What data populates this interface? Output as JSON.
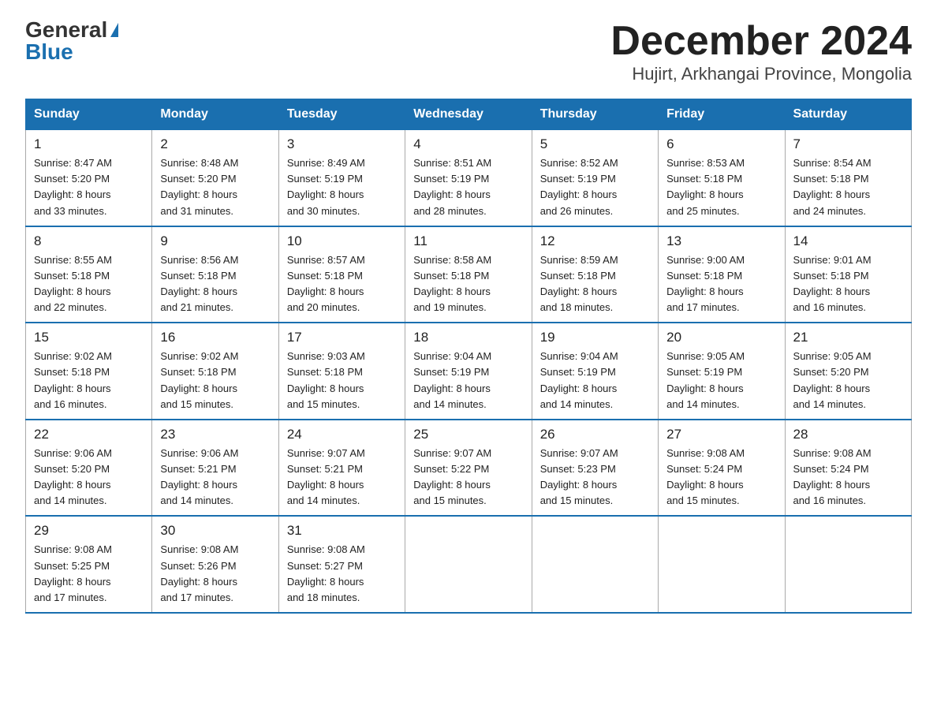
{
  "logo": {
    "general": "General",
    "blue": "Blue"
  },
  "title": "December 2024",
  "subtitle": "Hujirt, Arkhangai Province, Mongolia",
  "weekdays": [
    "Sunday",
    "Monday",
    "Tuesday",
    "Wednesday",
    "Thursday",
    "Friday",
    "Saturday"
  ],
  "weeks": [
    [
      {
        "day": "1",
        "sunrise": "8:47 AM",
        "sunset": "5:20 PM",
        "daylight": "8 hours and 33 minutes."
      },
      {
        "day": "2",
        "sunrise": "8:48 AM",
        "sunset": "5:20 PM",
        "daylight": "8 hours and 31 minutes."
      },
      {
        "day": "3",
        "sunrise": "8:49 AM",
        "sunset": "5:19 PM",
        "daylight": "8 hours and 30 minutes."
      },
      {
        "day": "4",
        "sunrise": "8:51 AM",
        "sunset": "5:19 PM",
        "daylight": "8 hours and 28 minutes."
      },
      {
        "day": "5",
        "sunrise": "8:52 AM",
        "sunset": "5:19 PM",
        "daylight": "8 hours and 26 minutes."
      },
      {
        "day": "6",
        "sunrise": "8:53 AM",
        "sunset": "5:18 PM",
        "daylight": "8 hours and 25 minutes."
      },
      {
        "day": "7",
        "sunrise": "8:54 AM",
        "sunset": "5:18 PM",
        "daylight": "8 hours and 24 minutes."
      }
    ],
    [
      {
        "day": "8",
        "sunrise": "8:55 AM",
        "sunset": "5:18 PM",
        "daylight": "8 hours and 22 minutes."
      },
      {
        "day": "9",
        "sunrise": "8:56 AM",
        "sunset": "5:18 PM",
        "daylight": "8 hours and 21 minutes."
      },
      {
        "day": "10",
        "sunrise": "8:57 AM",
        "sunset": "5:18 PM",
        "daylight": "8 hours and 20 minutes."
      },
      {
        "day": "11",
        "sunrise": "8:58 AM",
        "sunset": "5:18 PM",
        "daylight": "8 hours and 19 minutes."
      },
      {
        "day": "12",
        "sunrise": "8:59 AM",
        "sunset": "5:18 PM",
        "daylight": "8 hours and 18 minutes."
      },
      {
        "day": "13",
        "sunrise": "9:00 AM",
        "sunset": "5:18 PM",
        "daylight": "8 hours and 17 minutes."
      },
      {
        "day": "14",
        "sunrise": "9:01 AM",
        "sunset": "5:18 PM",
        "daylight": "8 hours and 16 minutes."
      }
    ],
    [
      {
        "day": "15",
        "sunrise": "9:02 AM",
        "sunset": "5:18 PM",
        "daylight": "8 hours and 16 minutes."
      },
      {
        "day": "16",
        "sunrise": "9:02 AM",
        "sunset": "5:18 PM",
        "daylight": "8 hours and 15 minutes."
      },
      {
        "day": "17",
        "sunrise": "9:03 AM",
        "sunset": "5:18 PM",
        "daylight": "8 hours and 15 minutes."
      },
      {
        "day": "18",
        "sunrise": "9:04 AM",
        "sunset": "5:19 PM",
        "daylight": "8 hours and 14 minutes."
      },
      {
        "day": "19",
        "sunrise": "9:04 AM",
        "sunset": "5:19 PM",
        "daylight": "8 hours and 14 minutes."
      },
      {
        "day": "20",
        "sunrise": "9:05 AM",
        "sunset": "5:19 PM",
        "daylight": "8 hours and 14 minutes."
      },
      {
        "day": "21",
        "sunrise": "9:05 AM",
        "sunset": "5:20 PM",
        "daylight": "8 hours and 14 minutes."
      }
    ],
    [
      {
        "day": "22",
        "sunrise": "9:06 AM",
        "sunset": "5:20 PM",
        "daylight": "8 hours and 14 minutes."
      },
      {
        "day": "23",
        "sunrise": "9:06 AM",
        "sunset": "5:21 PM",
        "daylight": "8 hours and 14 minutes."
      },
      {
        "day": "24",
        "sunrise": "9:07 AM",
        "sunset": "5:21 PM",
        "daylight": "8 hours and 14 minutes."
      },
      {
        "day": "25",
        "sunrise": "9:07 AM",
        "sunset": "5:22 PM",
        "daylight": "8 hours and 15 minutes."
      },
      {
        "day": "26",
        "sunrise": "9:07 AM",
        "sunset": "5:23 PM",
        "daylight": "8 hours and 15 minutes."
      },
      {
        "day": "27",
        "sunrise": "9:08 AM",
        "sunset": "5:24 PM",
        "daylight": "8 hours and 15 minutes."
      },
      {
        "day": "28",
        "sunrise": "9:08 AM",
        "sunset": "5:24 PM",
        "daylight": "8 hours and 16 minutes."
      }
    ],
    [
      {
        "day": "29",
        "sunrise": "9:08 AM",
        "sunset": "5:25 PM",
        "daylight": "8 hours and 17 minutes."
      },
      {
        "day": "30",
        "sunrise": "9:08 AM",
        "sunset": "5:26 PM",
        "daylight": "8 hours and 17 minutes."
      },
      {
        "day": "31",
        "sunrise": "9:08 AM",
        "sunset": "5:27 PM",
        "daylight": "8 hours and 18 minutes."
      },
      null,
      null,
      null,
      null
    ]
  ],
  "labels": {
    "sunrise": "Sunrise:",
    "sunset": "Sunset:",
    "daylight": "Daylight:"
  }
}
